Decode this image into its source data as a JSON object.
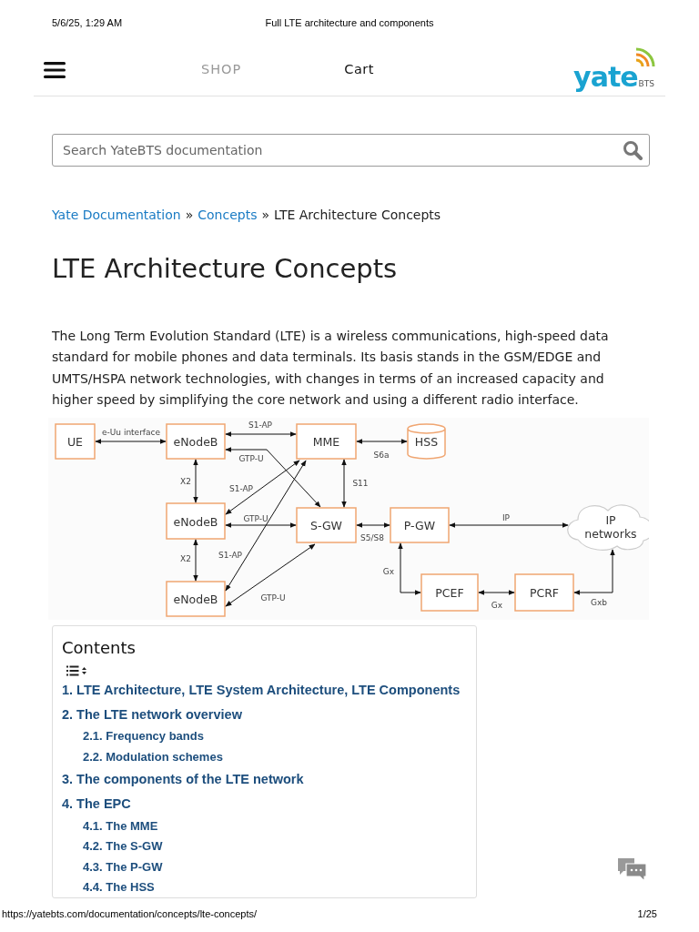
{
  "print_header": {
    "date": "5/6/25, 1:29 AM",
    "title": "Full LTE architecture and components"
  },
  "navbar": {
    "links": [
      {
        "label": "SHOP",
        "selected": false
      },
      {
        "label": "Cart",
        "selected": true
      }
    ],
    "logo": {
      "word": "yate",
      "sub": "BTS"
    }
  },
  "search": {
    "placeholder": "Search YateBTS documentation"
  },
  "breadcrumb": [
    {
      "label": "Yate Documentation",
      "kind": "link"
    },
    {
      "label": "»",
      "kind": "separator"
    },
    {
      "label": "Concepts",
      "kind": "link"
    },
    {
      "label": "»",
      "kind": "separator"
    },
    {
      "label": "LTE Architecture Concepts",
      "kind": "current"
    }
  ],
  "title": "LTE Architecture Concepts",
  "intro": "The Long Term Evolution Standard (LTE) is a wireless communications, high-speed data standard for mobile phones and data terminals. Its basis stands in the GSM/EDGE and UMTS/HSPA network technologies, with changes in terms of an increased capacity and higher speed by simplifying the core network and using a different radio interface.",
  "diagram": {
    "nodes": [
      {
        "label": "UE",
        "kind": "box"
      },
      {
        "label": "eNodeB",
        "kind": "box"
      },
      {
        "label": "MME",
        "kind": "box"
      },
      {
        "label": "HSS",
        "kind": "cylinder"
      },
      {
        "label": "eNodeB",
        "kind": "box"
      },
      {
        "label": "S-GW",
        "kind": "box"
      },
      {
        "label": "P-GW",
        "kind": "box"
      },
      {
        "label": "IP networks",
        "kind": "cloud"
      },
      {
        "label": "eNodeB",
        "kind": "box"
      },
      {
        "label": "PCEF",
        "kind": "box"
      },
      {
        "label": "PCRF",
        "kind": "box"
      }
    ],
    "links": [
      {
        "label": "e-Uu interface"
      },
      {
        "label": "S1-AP"
      },
      {
        "label": "GTP-U"
      },
      {
        "label": "S6a"
      },
      {
        "label": "X2"
      },
      {
        "label": "S11"
      },
      {
        "label": "S1-AP"
      },
      {
        "label": "GTP-U"
      },
      {
        "label": "S5/S8"
      },
      {
        "label": "IP"
      },
      {
        "label": "X2"
      },
      {
        "label": "S1-AP"
      },
      {
        "label": "GTP-U"
      },
      {
        "label": "Gx"
      },
      {
        "label": "Gx"
      },
      {
        "label": "Gxb"
      }
    ]
  },
  "contents": {
    "title": "Contents",
    "items": [
      {
        "label": "1. LTE Architecture, LTE System Architecture, LTE Components"
      },
      {
        "label": "2. The LTE network overview",
        "children": [
          {
            "label": "2.1. Frequency bands"
          },
          {
            "label": "2.2. Modulation schemes"
          }
        ]
      },
      {
        "label": "3. The components of the LTE network"
      },
      {
        "label": "4. The EPC",
        "children": [
          {
            "label": "4.1. The MME"
          },
          {
            "label": "4.2. The S-GW"
          },
          {
            "label": "4.3. The P-GW"
          },
          {
            "label": "4.4. The HSS"
          }
        ]
      }
    ]
  },
  "print_footer": {
    "url": "https://yatebts.com/documentation/concepts/lte-concepts/",
    "page": "1/25"
  }
}
